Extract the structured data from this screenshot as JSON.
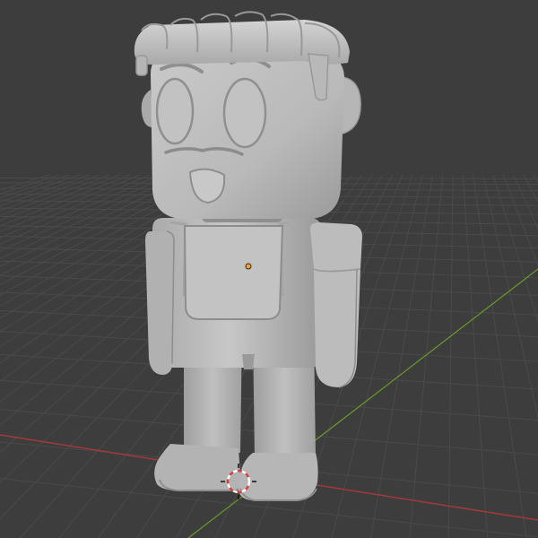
{
  "viewport": {
    "background_color": "#3d3d3d",
    "grid_color": "#4a4a4a",
    "x_axis_color": "#a23a3a",
    "y_axis_color": "#6b9a2a"
  },
  "object": {
    "base_color": "#bdbdbd",
    "shade_color": "#8e8e8e",
    "highlight_color": "#d8d8d8",
    "origin_color": "#f0a030"
  },
  "cursor": {
    "icon": "3d-cursor-icon",
    "ring_color": "#e23b3b",
    "ring_alt_color": "#ffffff"
  }
}
